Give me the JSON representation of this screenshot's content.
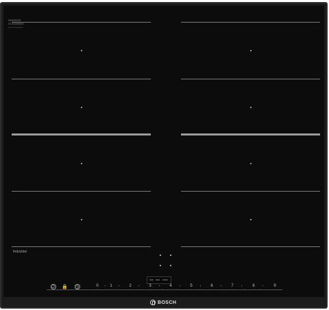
{
  "brand_label": {
    "line1": "SENSOR",
    "line2": "CLEANING",
    "line3": "FlexInduction"
  },
  "induction_label": "Induction",
  "logo": {
    "text": "BOSCH",
    "icon": "bosch-armature-icon"
  },
  "controls": {
    "icons": [
      "power-icon",
      "lock-icon",
      "timer-icon"
    ],
    "lock_symbol": "🔒",
    "power_symbol": "⏻",
    "timer_symbol": "◷",
    "slider_values": [
      "0",
      "1",
      "2",
      "3",
      "4",
      "5",
      "6",
      "7",
      "8",
      "9"
    ]
  },
  "colors": {
    "glass": "#0c0c0c",
    "frame": "#1c1c1c",
    "marking": "#7a7a7a"
  }
}
